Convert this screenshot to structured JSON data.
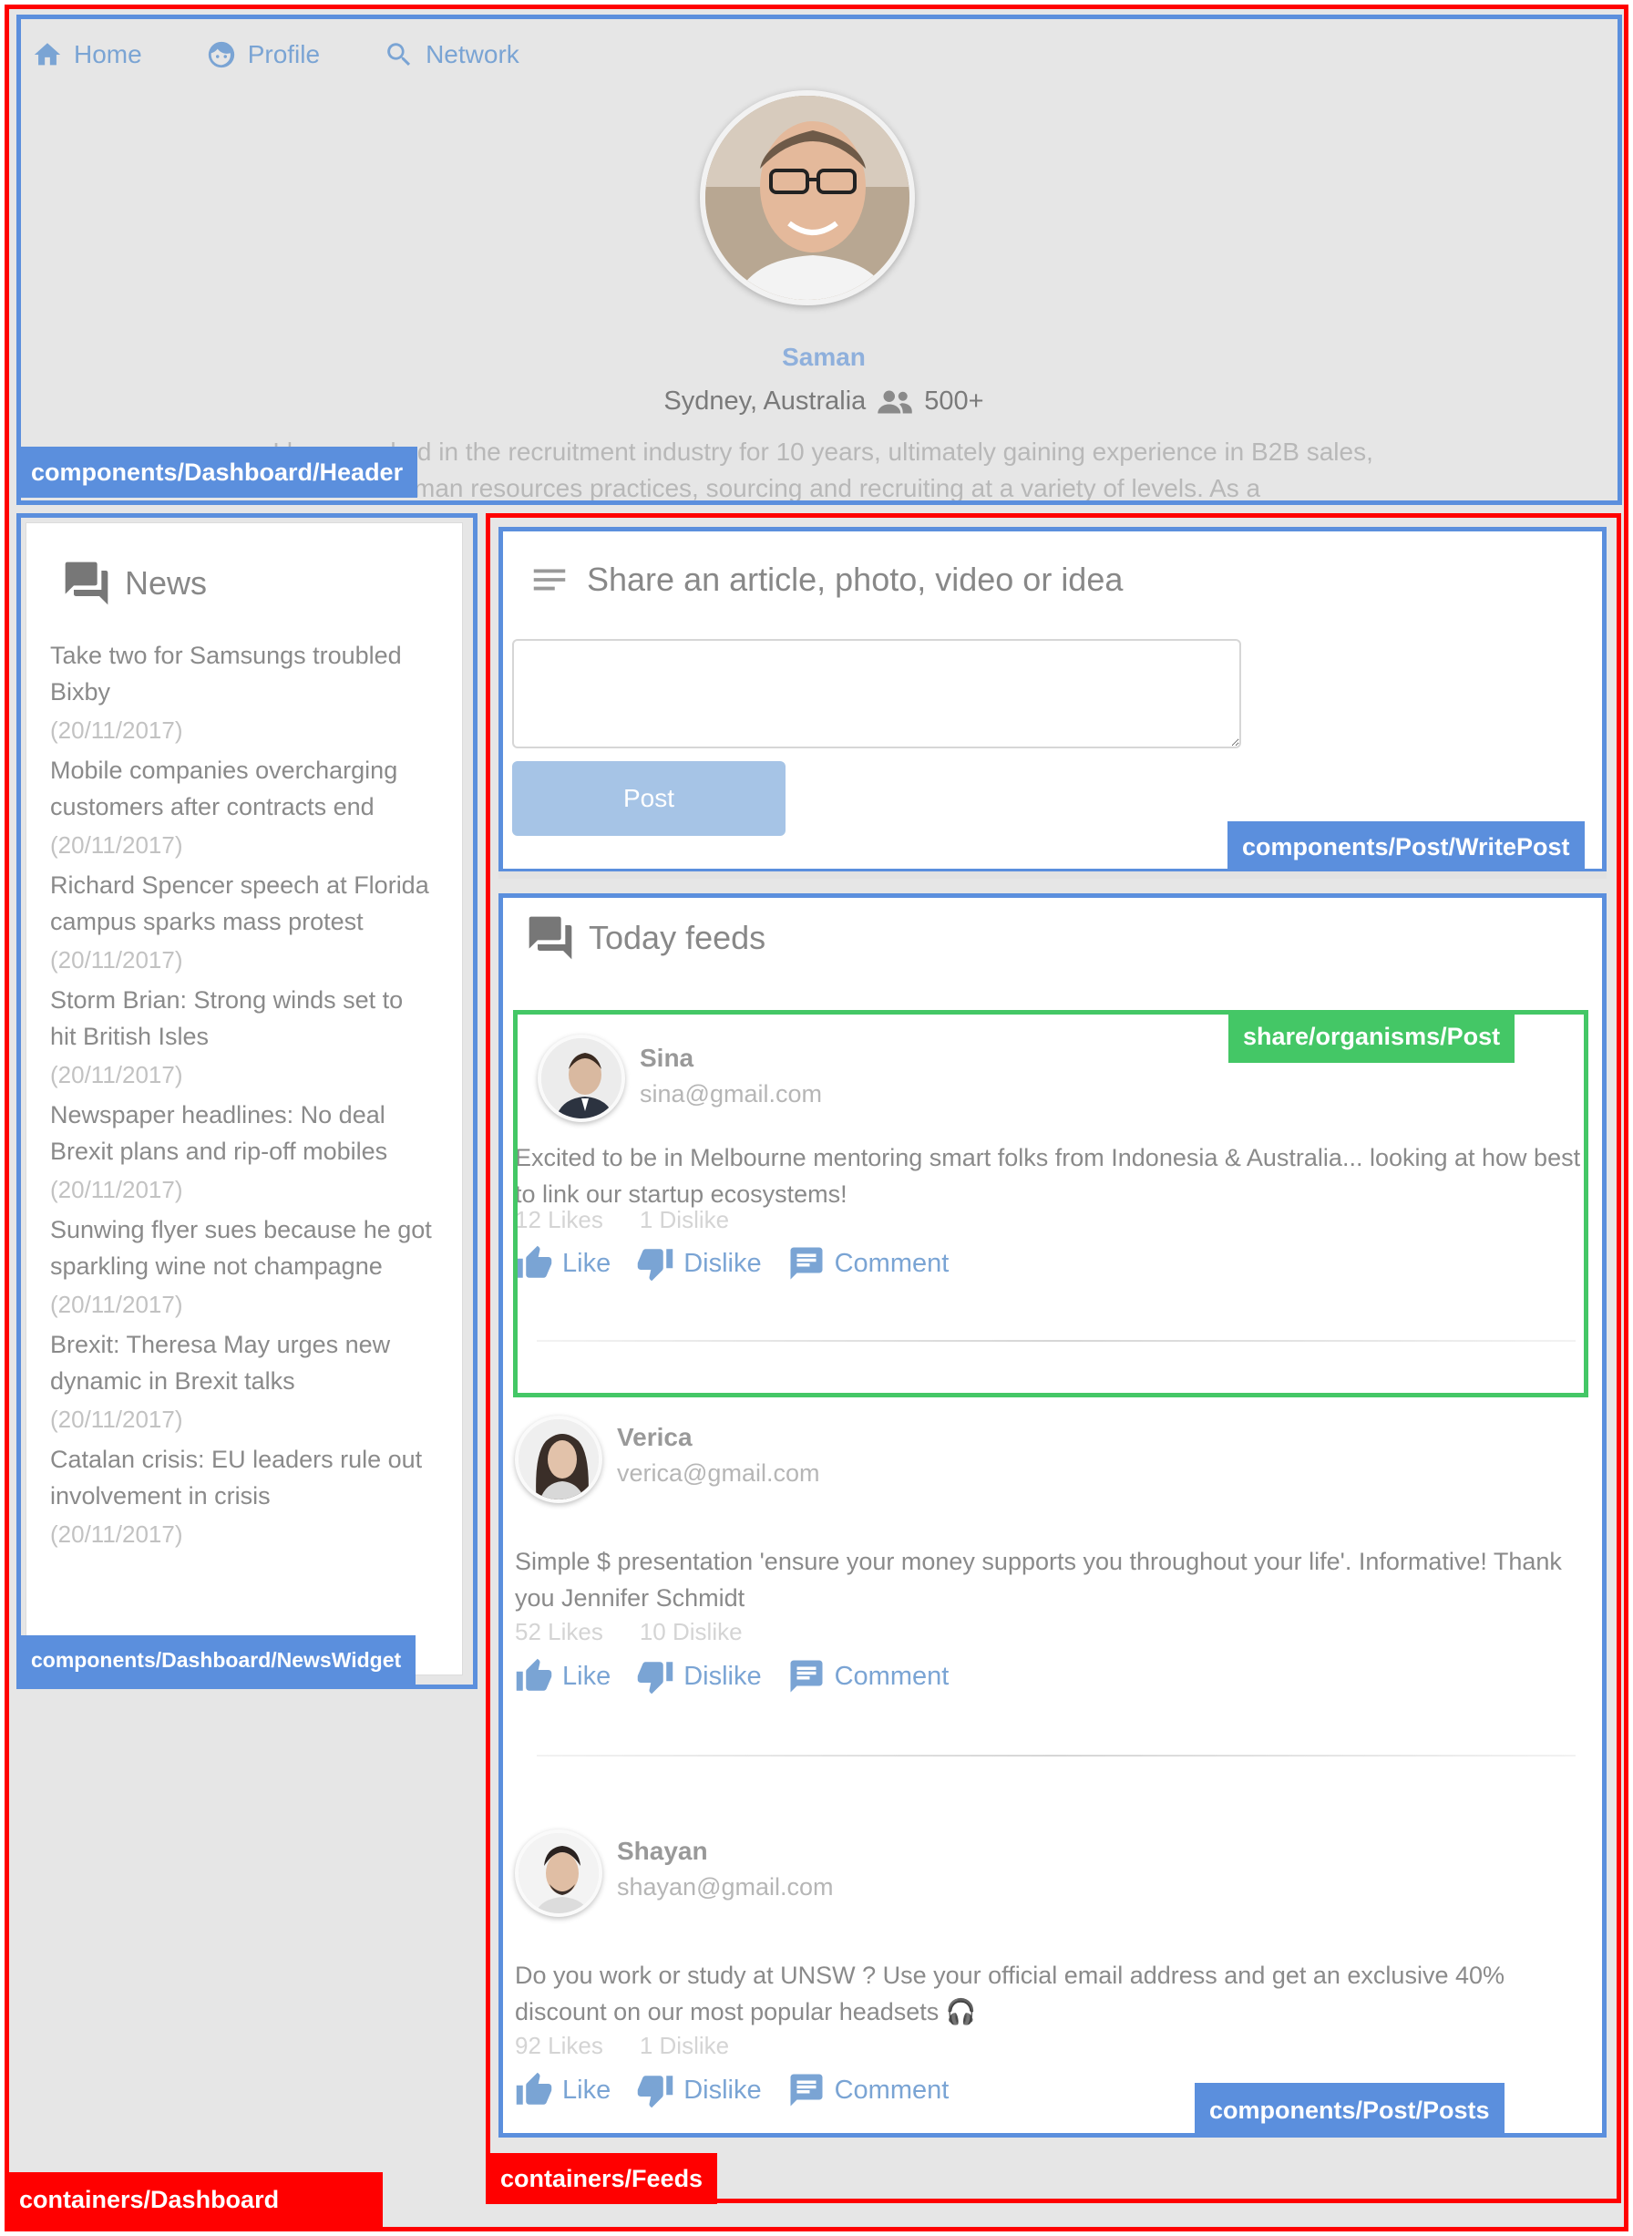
{
  "nav": {
    "home": "Home",
    "profile": "Profile",
    "network": "Network"
  },
  "header": {
    "name": "Saman",
    "location": "Sydney, Australia",
    "connections": "500+",
    "bio": "I have worked in the recruitment industry for 10 years, ultimately gaining experience in B2B sales, human resources practices, sourcing and recruiting at a variety of levels. As a"
  },
  "news": {
    "title": "News",
    "items": [
      {
        "headline": "Take two for Samsungs troubled Bixby",
        "date": "(20/11/2017)"
      },
      {
        "headline": "Mobile companies overcharging customers after contracts end",
        "date": "(20/11/2017)"
      },
      {
        "headline": "Richard Spencer speech at Florida campus sparks mass protest",
        "date": "(20/11/2017)"
      },
      {
        "headline": "Storm Brian: Strong winds set to hit British Isles",
        "date": "(20/11/2017)"
      },
      {
        "headline": "Newspaper headlines: No deal Brexit plans and rip-off mobiles",
        "date": "(20/11/2017)"
      },
      {
        "headline": "Sunwing flyer sues because he got sparkling wine not champagne",
        "date": "(20/11/2017)"
      },
      {
        "headline": "Brexit: Theresa May urges new dynamic in Brexit talks",
        "date": "(20/11/2017)"
      },
      {
        "headline": "Catalan crisis: EU leaders rule out involvement in crisis",
        "date": "(20/11/2017)"
      }
    ]
  },
  "writepost": {
    "title": "Share an article, photo, video or idea",
    "textarea_value": "",
    "post_label": "Post"
  },
  "feeds": {
    "title": "Today feeds",
    "posts": [
      {
        "name": "Sina",
        "email": "sina@gmail.com",
        "text": "Excited to be in Melbourne mentoring smart folks from Indonesia & Australia... looking at how best to link our startup ecosystems!",
        "likes": "12 Likes",
        "dislikes": "1 Dislike",
        "like_label": "Like",
        "dislike_label": "Dislike",
        "comment_label": "Comment"
      },
      {
        "name": "Verica",
        "email": "verica@gmail.com",
        "text": "Simple $ presentation 'ensure your money supports you throughout your life'. Informative! Thank you Jennifer Schmidt",
        "likes": "52 Likes",
        "dislikes": "10 Dislike",
        "like_label": "Like",
        "dislike_label": "Dislike",
        "comment_label": "Comment"
      },
      {
        "name": "Shayan",
        "email": "shayan@gmail.com",
        "text": "Do you work or study at UNSW ? Use your official email address and get an exclusive 40% discount on our most popular headsets 🎧",
        "likes": "92 Likes",
        "dislikes": "1 Dislike",
        "like_label": "Like",
        "dislike_label": "Dislike",
        "comment_label": "Comment"
      }
    ]
  },
  "annotations": {
    "header": "components/Dashboard/Header",
    "news_widget": "components/Dashboard/NewsWidget",
    "write_post": "components/Post/WritePost",
    "post_organism": "share/organisms/Post",
    "posts": "components/Post/Posts",
    "feeds": "containers/Feeds",
    "dashboard": "containers/Dashboard"
  },
  "colors": {
    "container_outline": "#ff0000",
    "component_outline": "#5b8fdd",
    "organism_outline": "#44c766",
    "link_blue": "#7aa4d4"
  }
}
